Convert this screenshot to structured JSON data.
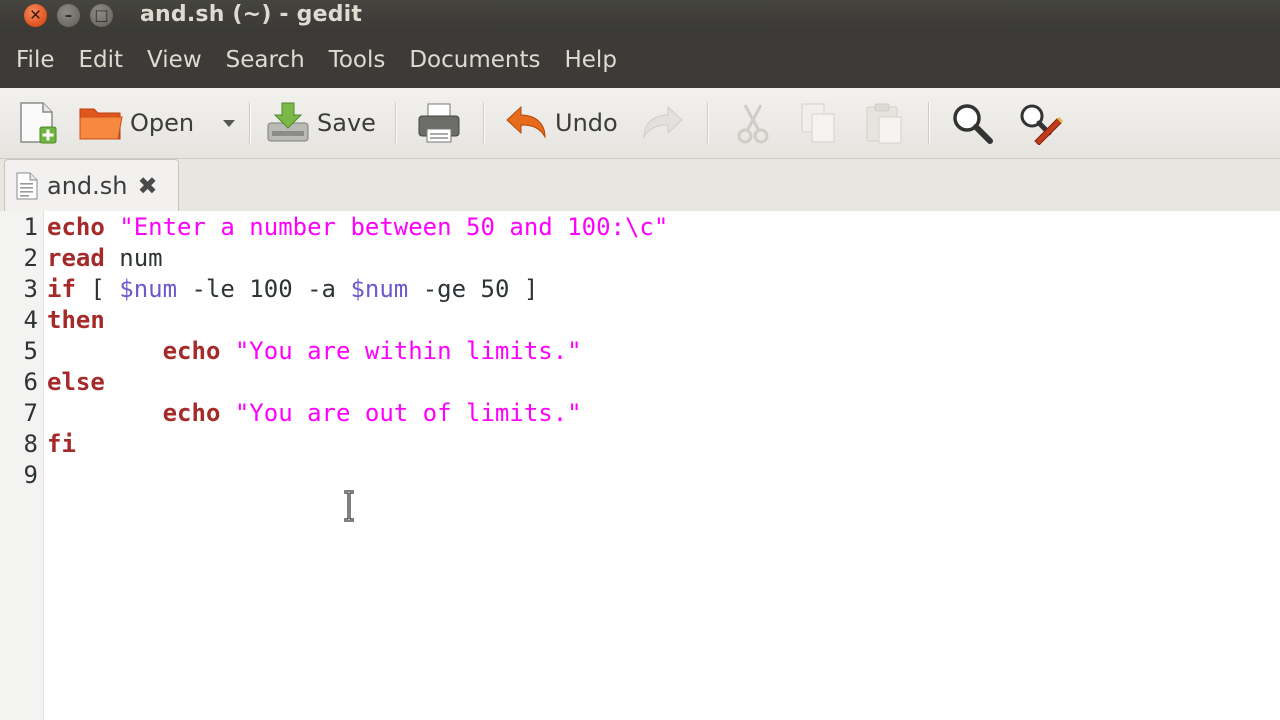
{
  "window": {
    "title": "and.sh (~) - gedit",
    "buttons": {
      "close": "✕",
      "minimize": "–",
      "maximize": "□"
    }
  },
  "menu": [
    "File",
    "Edit",
    "View",
    "Search",
    "Tools",
    "Documents",
    "Help"
  ],
  "toolbar": {
    "open_label": "Open",
    "save_label": "Save",
    "undo_label": "Undo"
  },
  "tab": {
    "label": "and.sh"
  },
  "editor": {
    "lines": [
      {
        "n": "1",
        "parts": [
          {
            "t": "echo",
            "c": "kw"
          },
          {
            "t": " ",
            "c": ""
          },
          {
            "t": "\"Enter a number between 50 and 100:\\c\"",
            "c": "str"
          }
        ]
      },
      {
        "n": "2",
        "parts": [
          {
            "t": "read",
            "c": "kw"
          },
          {
            "t": " num",
            "c": ""
          }
        ]
      },
      {
        "n": "3",
        "parts": [
          {
            "t": "if",
            "c": "kw"
          },
          {
            "t": " [ ",
            "c": ""
          },
          {
            "t": "$num",
            "c": "var"
          },
          {
            "t": " -le 100 -a ",
            "c": ""
          },
          {
            "t": "$num",
            "c": "var"
          },
          {
            "t": " -ge 50 ]",
            "c": ""
          }
        ]
      },
      {
        "n": "4",
        "parts": [
          {
            "t": "then",
            "c": "kw"
          }
        ]
      },
      {
        "n": "5",
        "parts": [
          {
            "t": "        ",
            "c": ""
          },
          {
            "t": "echo",
            "c": "kw"
          },
          {
            "t": " ",
            "c": ""
          },
          {
            "t": "\"You are within limits.\"",
            "c": "str"
          }
        ]
      },
      {
        "n": "6",
        "parts": [
          {
            "t": "else",
            "c": "kw"
          }
        ]
      },
      {
        "n": "7",
        "parts": [
          {
            "t": "        ",
            "c": ""
          },
          {
            "t": "echo",
            "c": "kw"
          },
          {
            "t": " ",
            "c": ""
          },
          {
            "t": "\"You are out of limits.\"",
            "c": "str"
          }
        ]
      },
      {
        "n": "8",
        "parts": [
          {
            "t": "fi",
            "c": "kw"
          }
        ]
      },
      {
        "n": "9",
        "parts": []
      }
    ]
  },
  "colors": {
    "keyword": "#a52a2a",
    "string": "#ff00ff",
    "variable": "#6a5acd",
    "close_button": "#e2551f"
  },
  "icons": [
    "new-document-icon",
    "open-folder-icon",
    "save-icon",
    "print-icon",
    "undo-icon",
    "redo-icon",
    "cut-icon",
    "copy-icon",
    "paste-icon",
    "search-icon",
    "replace-icon",
    "text-file-icon",
    "tab-close-icon"
  ]
}
